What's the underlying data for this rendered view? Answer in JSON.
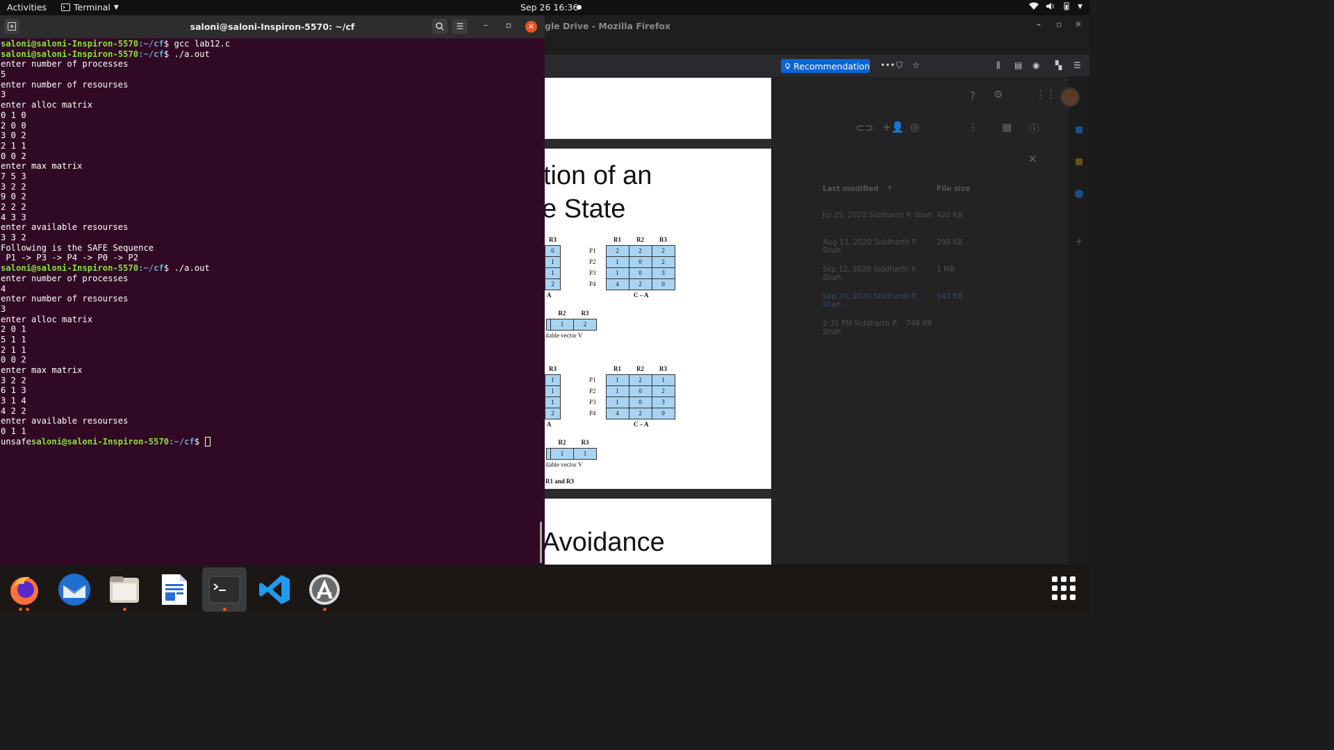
{
  "topbar": {
    "activities": "Activities",
    "app_name": "Terminal",
    "clock": "Sep 26  16:36"
  },
  "firefox": {
    "title": "gle Drive - Mozilla Firefox",
    "recommendation": "Recommendation",
    "drive": {
      "col_last_modified": "Last modified",
      "col_file_size": "File size",
      "rows": [
        {
          "modified": "Jul 25, 2020  Siddharth P. Shah",
          "size": "920 KB"
        },
        {
          "modified": "Aug 13, 2020  Siddharth P. Shah",
          "size": "298 KB"
        },
        {
          "modified": "Sep 12, 2020  Siddharth P. Shah",
          "size": "1 MB"
        },
        {
          "modified": "Sep 20, 2020  Siddharth P. Shah",
          "size": "943 KB"
        },
        {
          "modified": "2:31 PM  Siddharth P. Shah",
          "size": "748 KB"
        }
      ]
    },
    "pdf": {
      "heading_line1": "tion of an",
      "heading_line2": "e State",
      "footer_heading": "Avoidance",
      "col_headers": [
        "R1",
        "R2",
        "R3"
      ],
      "partial_header": "R3",
      "row_labels": [
        "P1",
        "P2",
        "P3",
        "P4"
      ],
      "matrix1_partial": [
        "0",
        "1",
        "1",
        "2"
      ],
      "matrix1_ca": [
        [
          "2",
          "2",
          "2"
        ],
        [
          "1",
          "0",
          "2"
        ],
        [
          "1",
          "0",
          "3"
        ],
        [
          "4",
          "2",
          "0"
        ]
      ],
      "matrix2_partial": [
        "1",
        "1",
        "1",
        "2"
      ],
      "matrix2_ca": [
        [
          "1",
          "2",
          "1"
        ],
        [
          "1",
          "0",
          "2"
        ],
        [
          "1",
          "0",
          "3"
        ],
        [
          "4",
          "2",
          "0"
        ]
      ],
      "caption_a": "A",
      "caption_ca": "C – A",
      "vector_headers": [
        "R2",
        "R3"
      ],
      "vector1": [
        "1",
        "2"
      ],
      "vector2": [
        "1",
        "1"
      ],
      "vector_caption": "ilable vector V",
      "bottom_note": "R1 and R3"
    }
  },
  "terminal": {
    "title": "saloni@saloni-Inspiron-5570: ~/cf",
    "prompt_user": "saloni@saloni-Inspiron-5570",
    "prompt_path": ":~/cf",
    "lines": [
      {
        "type": "prompt",
        "cmd": " gcc lab12.c"
      },
      {
        "type": "prompt",
        "cmd": " ./a.out"
      },
      {
        "type": "out",
        "text": "enter number of processes"
      },
      {
        "type": "out",
        "text": "5"
      },
      {
        "type": "out",
        "text": "enter number of resourses"
      },
      {
        "type": "out",
        "text": "3"
      },
      {
        "type": "out",
        "text": "enter alloc matrix"
      },
      {
        "type": "out",
        "text": "0 1 0"
      },
      {
        "type": "out",
        "text": "2 0 0"
      },
      {
        "type": "out",
        "text": "3 0 2"
      },
      {
        "type": "out",
        "text": "2 1 1"
      },
      {
        "type": "out",
        "text": "0 0 2"
      },
      {
        "type": "out",
        "text": "enter max matrix"
      },
      {
        "type": "out",
        "text": "7 5 3"
      },
      {
        "type": "out",
        "text": "3 2 2"
      },
      {
        "type": "out",
        "text": "9 0 2"
      },
      {
        "type": "out",
        "text": "2 2 2"
      },
      {
        "type": "out",
        "text": "4 3 3"
      },
      {
        "type": "out",
        "text": "enter available resourses"
      },
      {
        "type": "out",
        "text": "3 3 2"
      },
      {
        "type": "out",
        "text": "Following is the SAFE Sequence"
      },
      {
        "type": "out",
        "text": " P1 -> P3 -> P4 -> P0 -> P2"
      },
      {
        "type": "prompt",
        "cmd": " ./a.out"
      },
      {
        "type": "out",
        "text": "enter number of processes"
      },
      {
        "type": "out",
        "text": "4"
      },
      {
        "type": "out",
        "text": "enter number of resourses"
      },
      {
        "type": "out",
        "text": "3"
      },
      {
        "type": "out",
        "text": "enter alloc matrix"
      },
      {
        "type": "out",
        "text": "2 0 1"
      },
      {
        "type": "out",
        "text": "5 1 1"
      },
      {
        "type": "out",
        "text": "2 1 1"
      },
      {
        "type": "out",
        "text": "0 0 2"
      },
      {
        "type": "out",
        "text": "enter max matrix"
      },
      {
        "type": "out",
        "text": "3 2 2"
      },
      {
        "type": "out",
        "text": "6 1 3"
      },
      {
        "type": "out",
        "text": "3 1 4"
      },
      {
        "type": "out",
        "text": "4 2 2"
      },
      {
        "type": "out",
        "text": "enter available resourses"
      },
      {
        "type": "out",
        "text": "0 1 1"
      },
      {
        "type": "final",
        "text": "unsafe",
        "cmd": " "
      }
    ]
  },
  "dock": [
    "firefox-icon",
    "thunderbird-icon",
    "files-icon",
    "writer-icon",
    "terminal-icon",
    "vscode-icon",
    "software-icon"
  ],
  "colors": {
    "terminal_bg": "#300a24",
    "prompt_user": "#8ae234",
    "prompt_path": "#729fcf",
    "accent": "#e95420",
    "matrix_cell": "#a9d3f2"
  }
}
